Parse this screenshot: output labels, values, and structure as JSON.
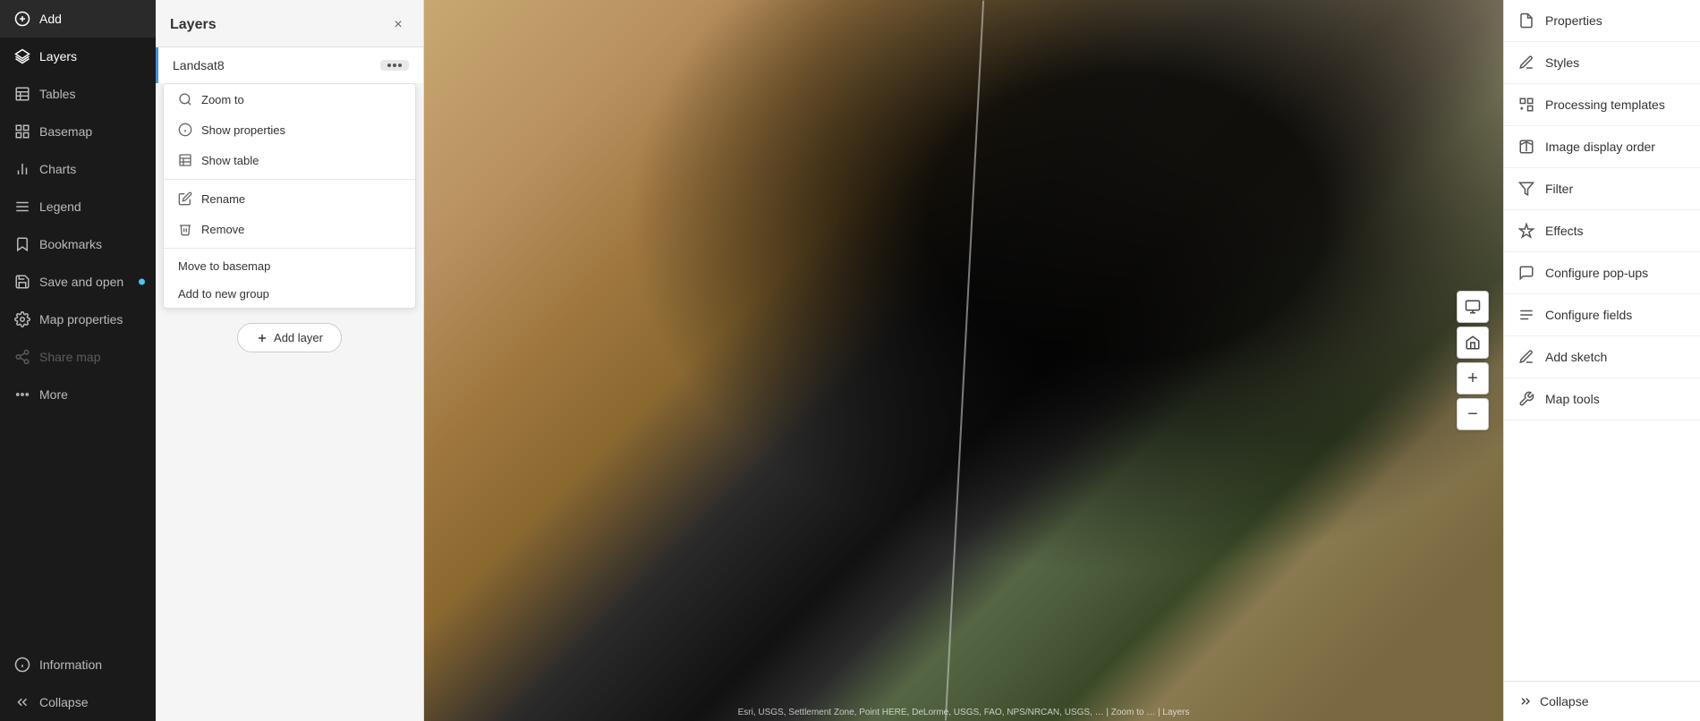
{
  "left_sidebar": {
    "items": [
      {
        "id": "add",
        "label": "Add",
        "icon": "plus-circle"
      },
      {
        "id": "layers",
        "label": "Layers",
        "icon": "layers",
        "active": true
      },
      {
        "id": "tables",
        "label": "Tables",
        "icon": "table"
      },
      {
        "id": "basemap",
        "label": "Basemap",
        "icon": "basemap"
      },
      {
        "id": "charts",
        "label": "Charts",
        "icon": "chart"
      },
      {
        "id": "legend",
        "label": "Legend",
        "icon": "legend"
      },
      {
        "id": "bookmarks",
        "label": "Bookmarks",
        "icon": "bookmark"
      },
      {
        "id": "save-open",
        "label": "Save and open",
        "icon": "save",
        "has_dot": true
      },
      {
        "id": "map-properties",
        "label": "Map properties",
        "icon": "gear"
      },
      {
        "id": "share-map",
        "label": "Share map",
        "icon": "share",
        "disabled": true
      },
      {
        "id": "more",
        "label": "More",
        "icon": "more"
      },
      {
        "id": "information",
        "label": "Information",
        "icon": "info"
      },
      {
        "id": "collapse",
        "label": "Collapse",
        "icon": "chevrons-left"
      }
    ]
  },
  "layers_panel": {
    "title": "Layers",
    "close_label": "×",
    "layer": {
      "name": "Landsat8",
      "more_btn_dots": "···"
    },
    "context_menu": {
      "items": [
        {
          "id": "zoom-to",
          "label": "Zoom to",
          "icon": "zoom"
        },
        {
          "id": "show-properties",
          "label": "Show properties",
          "icon": "info-circle"
        },
        {
          "id": "show-table",
          "label": "Show table",
          "icon": "table-small"
        },
        {
          "id": "rename",
          "label": "Rename",
          "icon": "pencil"
        },
        {
          "id": "remove",
          "label": "Remove",
          "icon": "trash"
        }
      ],
      "plain_items": [
        {
          "id": "move-basemap",
          "label": "Move to basemap"
        },
        {
          "id": "add-group",
          "label": "Add to new group"
        }
      ]
    },
    "add_layer_label": "+ Add layer"
  },
  "map": {
    "credit": "Esri, USGS, Settlement Zone, Point HERE, DeLorme, USGS, FAO, NPS/NRCAN, USGS, … | Zoom to … | Layers"
  },
  "right_sidebar": {
    "items": [
      {
        "id": "properties",
        "label": "Properties",
        "icon": "properties"
      },
      {
        "id": "styles",
        "label": "Styles",
        "icon": "styles"
      },
      {
        "id": "processing-templates",
        "label": "Processing templates",
        "icon": "processing"
      },
      {
        "id": "image-display-order",
        "label": "Image display order",
        "icon": "image-order"
      },
      {
        "id": "filter",
        "label": "Filter",
        "icon": "filter"
      },
      {
        "id": "effects",
        "label": "Effects",
        "icon": "effects"
      },
      {
        "id": "configure-popups",
        "label": "Configure pop-ups",
        "icon": "popup"
      },
      {
        "id": "configure-fields",
        "label": "Configure fields",
        "icon": "fields"
      },
      {
        "id": "add-sketch",
        "label": "Add sketch",
        "icon": "sketch"
      },
      {
        "id": "map-tools",
        "label": "Map tools",
        "icon": "tools"
      }
    ],
    "collapse_label": "Collapse"
  }
}
